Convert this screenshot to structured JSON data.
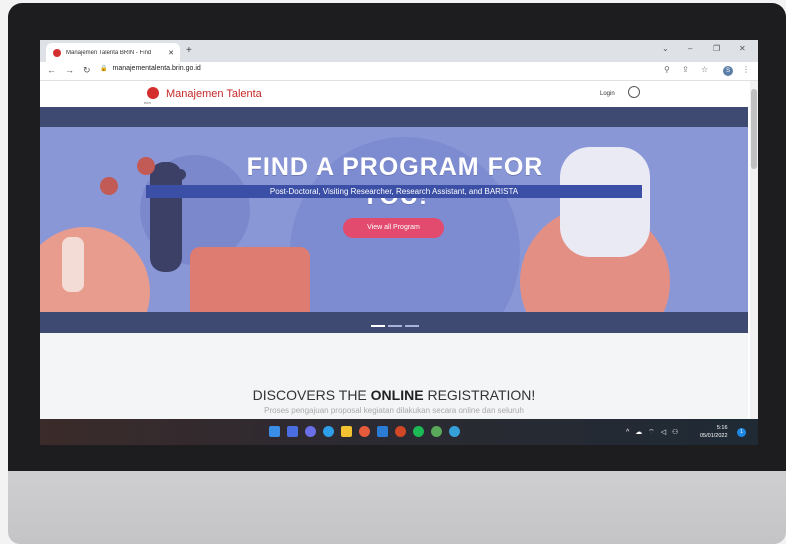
{
  "browser": {
    "tab_title": "Manajemen Talenta BRIN - Find",
    "tab_close": "✕",
    "new_tab": "+",
    "url": "manajementalenta.brin.go.id",
    "profile_initial": "S",
    "controls": {
      "minimize": "–",
      "restore": "❐",
      "close": "✕",
      "tab_list": "⌄"
    },
    "nav": {
      "back": "←",
      "forward": "→",
      "reload": "↻"
    },
    "toolbar_icons": {
      "zoom": "⚲",
      "share": "⇪",
      "bookmark": "☆",
      "menu": "⋮"
    }
  },
  "site": {
    "logo_sub": "BRIN",
    "brand": "Manajemen Talenta",
    "login": "Login"
  },
  "hero": {
    "title": "FIND A PROGRAM FOR YOU!",
    "subtitle": "Post-Doctoral, Visiting Researcher, Research Assistant, and BARISTA",
    "cta": "View all Program"
  },
  "content": {
    "heading_prefix": "DISCOVERS THE ",
    "heading_bold": "ONLINE",
    "heading_suffix": " REGISTRATION!",
    "subtext": "Proses pengajuan proposal kegiatan dilakukan secara online dan seluruh"
  },
  "taskbar": {
    "tray": "^ ☁ ⌔ ◁ ⚇",
    "time": "5:16",
    "date": "05/01/2022",
    "notification_count": "1"
  },
  "colors": {
    "hero_bg": "#8a97d7",
    "hero_band": "#3f4a73",
    "cta": "#e24a6e",
    "brand": "#c62828"
  }
}
